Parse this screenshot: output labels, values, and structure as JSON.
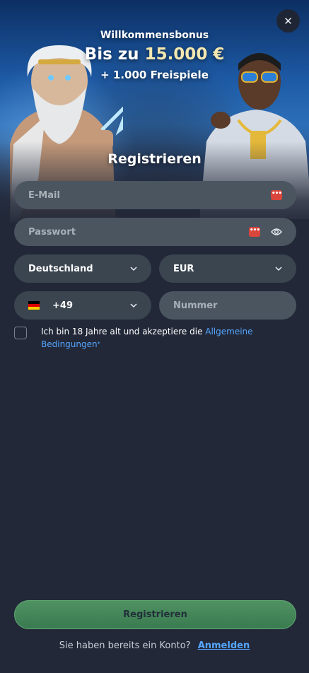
{
  "header": {
    "close_icon": "close-icon",
    "bonus_line1": "Willkommensbonus",
    "bonus_prefix": "Bis zu ",
    "bonus_amount": "15.000 €",
    "bonus_line3": "+ 1.000 Freispiele"
  },
  "form": {
    "title": "Registrieren",
    "email_placeholder": "E-Mail",
    "password_placeholder": "Passwort",
    "password_manager_icon": "password-manager-icon",
    "eye_icon": "eye-icon",
    "country_value": "Deutschland",
    "currency_value": "EUR",
    "phone_prefix": "+49",
    "phone_placeholder": "Nummer",
    "flag_icon": "germany-flag-icon",
    "terms_text": "Ich bin 18 Jahre alt und akzeptiere die ",
    "terms_link": "Allgemeine Bedingungen",
    "terms_star": "*",
    "terms_checked": false
  },
  "footer": {
    "submit_label": "Registrieren",
    "login_prompt": "Sie haben bereits ein Konto?",
    "login_link": "Anmelden"
  },
  "colors": {
    "background": "#222838",
    "field": "#4b5560",
    "accent_link": "#55a6ff",
    "submit": "#3f8558",
    "bonus_amount": "#f4e7b0"
  }
}
